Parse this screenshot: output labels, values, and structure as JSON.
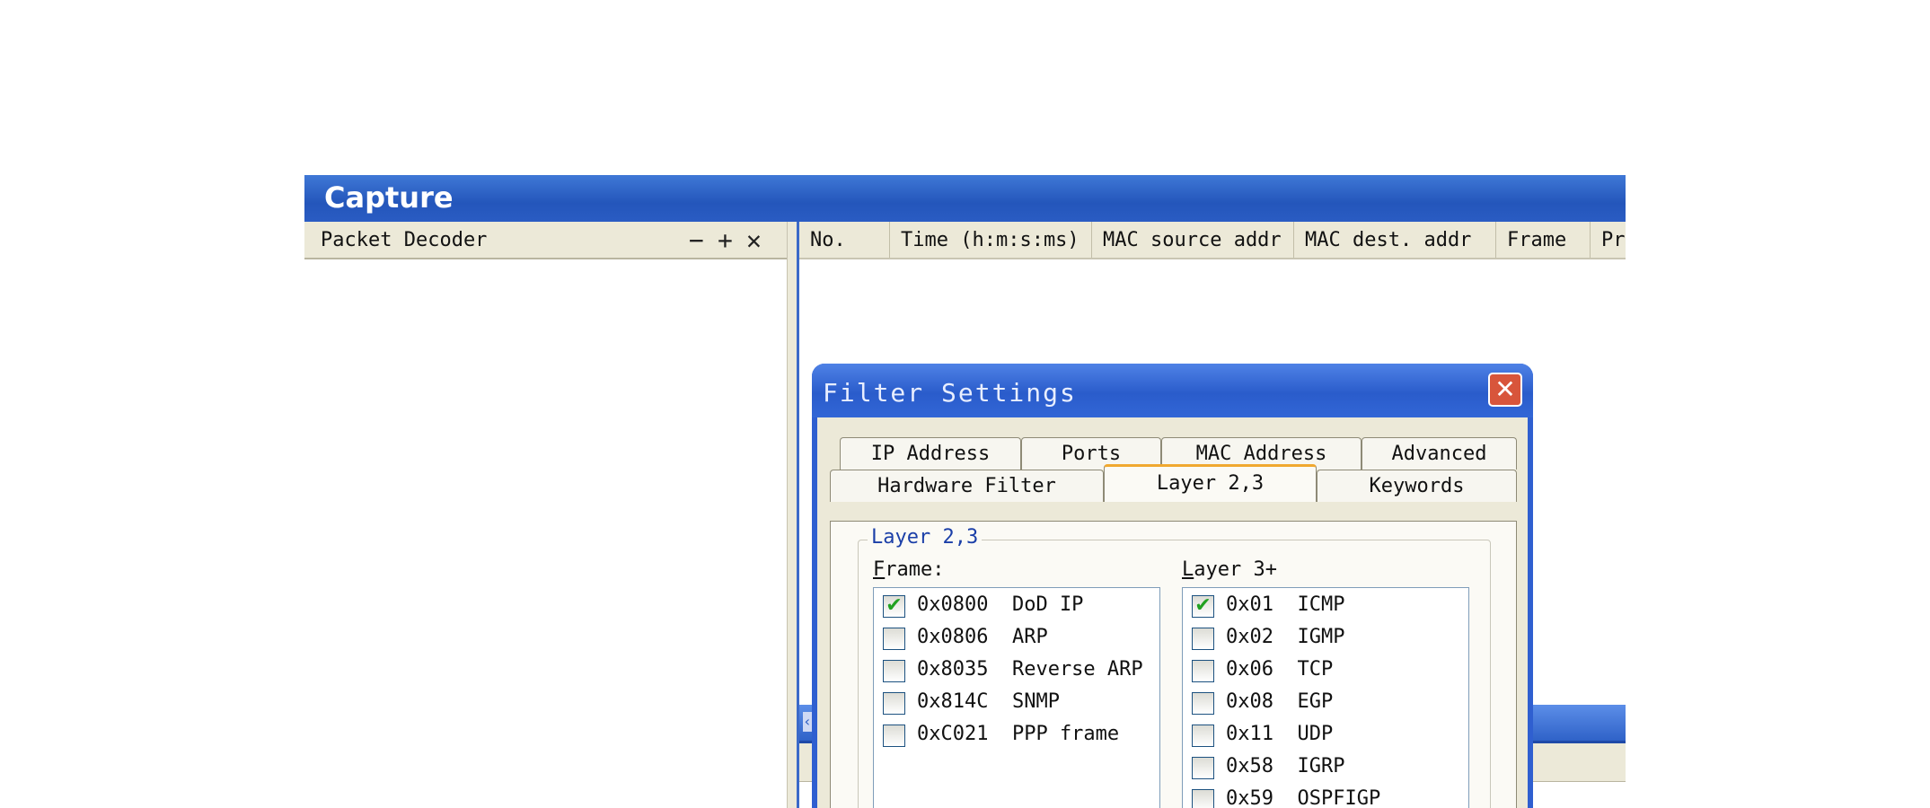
{
  "window": {
    "title": "Capture"
  },
  "packet_decoder": {
    "label": "Packet Decoder",
    "minimize": "−",
    "add": "+",
    "close": "✕"
  },
  "columns": [
    {
      "label": "No."
    },
    {
      "label": "Time (h:m:s:ms)"
    },
    {
      "label": "MAC source addr"
    },
    {
      "label": "MAC dest. addr"
    },
    {
      "label": "Frame"
    },
    {
      "label": "Pro"
    }
  ],
  "dialog": {
    "title": "Filter Settings",
    "close": "✕",
    "tabs_row1": [
      {
        "label": "IP Address"
      },
      {
        "label": "Ports"
      },
      {
        "label": "MAC Address"
      },
      {
        "label": "Advanced"
      }
    ],
    "tabs_row2": [
      {
        "label": "Hardware Filter"
      },
      {
        "label": "Layer 2,3"
      },
      {
        "label": "Keywords"
      }
    ],
    "active_tab": "Layer 2,3",
    "group_title": "Layer 2,3",
    "frame_label": {
      "first": "F",
      "rest": "rame:"
    },
    "layer3_label": {
      "first": "L",
      "rest": "ayer 3+"
    },
    "frame_items": [
      {
        "text": "0x0800  DoD IP",
        "checked": true
      },
      {
        "text": "0x0806  ARP",
        "checked": false
      },
      {
        "text": "0x8035  Reverse ARP",
        "checked": false
      },
      {
        "text": "0x814C  SNMP",
        "checked": false
      },
      {
        "text": "0xC021  PPP frame",
        "checked": false
      }
    ],
    "layer3_items": [
      {
        "text": "0x01  ICMP",
        "checked": true
      },
      {
        "text": "0x02  IGMP",
        "checked": false
      },
      {
        "text": "0x06  TCP",
        "checked": false
      },
      {
        "text": "0x08  EGP",
        "checked": false
      },
      {
        "text": "0x11  UDP",
        "checked": false
      },
      {
        "text": "0x58  IGRP",
        "checked": false
      },
      {
        "text": "0x59  OSPFIGP",
        "checked": false
      }
    ]
  },
  "check_mark": "✔"
}
